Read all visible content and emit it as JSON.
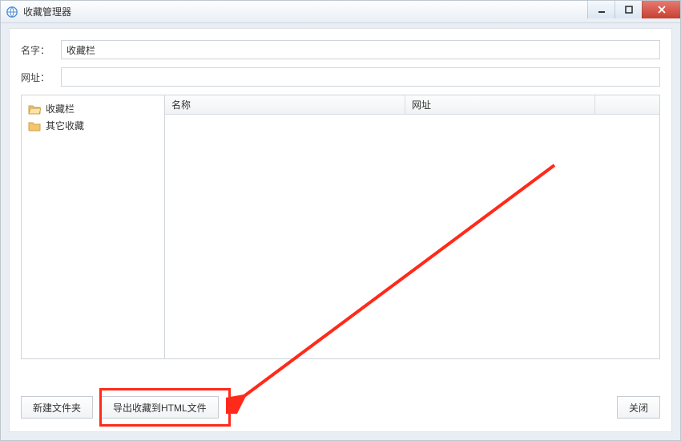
{
  "window": {
    "title": "收藏管理器"
  },
  "form": {
    "name_label": "名字：",
    "name_value": "收藏栏",
    "url_label": "网址：",
    "url_value": ""
  },
  "tree": {
    "items": [
      {
        "label": "收藏栏",
        "open": true
      },
      {
        "label": "其它收藏",
        "open": false
      }
    ]
  },
  "grid": {
    "columns": {
      "name": "名称",
      "url": "网址"
    }
  },
  "buttons": {
    "new_folder": "新建文件夹",
    "export_html": "导出收藏到HTML文件",
    "close": "关闭"
  }
}
